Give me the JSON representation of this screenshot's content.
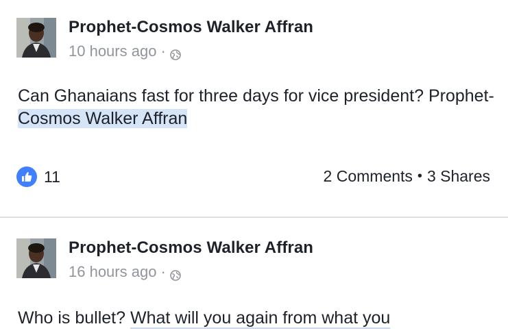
{
  "posts": [
    {
      "author": "Prophet-Cosmos Walker Affran",
      "time": "10 hours ago",
      "meta_separator": "·",
      "privacy_icon": "globe-icon",
      "text_prefix": "Can Ghanaians fast for three days for vice president? Prophet-",
      "text_highlight": "Cosmos Walker Affran",
      "like_count": "11",
      "comments": "2 Comments",
      "separator": "•",
      "shares": "3 Shares"
    },
    {
      "author": "Prophet-Cosmos Walker Affran",
      "time": "16 hours ago",
      "meta_separator": "·",
      "privacy_icon": "globe-icon",
      "text_prefix": "Who is bullet? ",
      "text_link": "What will you again from what you"
    }
  ],
  "colors": {
    "like_blue": "#4080ff",
    "meta_gray": "#90949c",
    "highlight": "#d6e4f8",
    "divider": "#dde1e6"
  }
}
